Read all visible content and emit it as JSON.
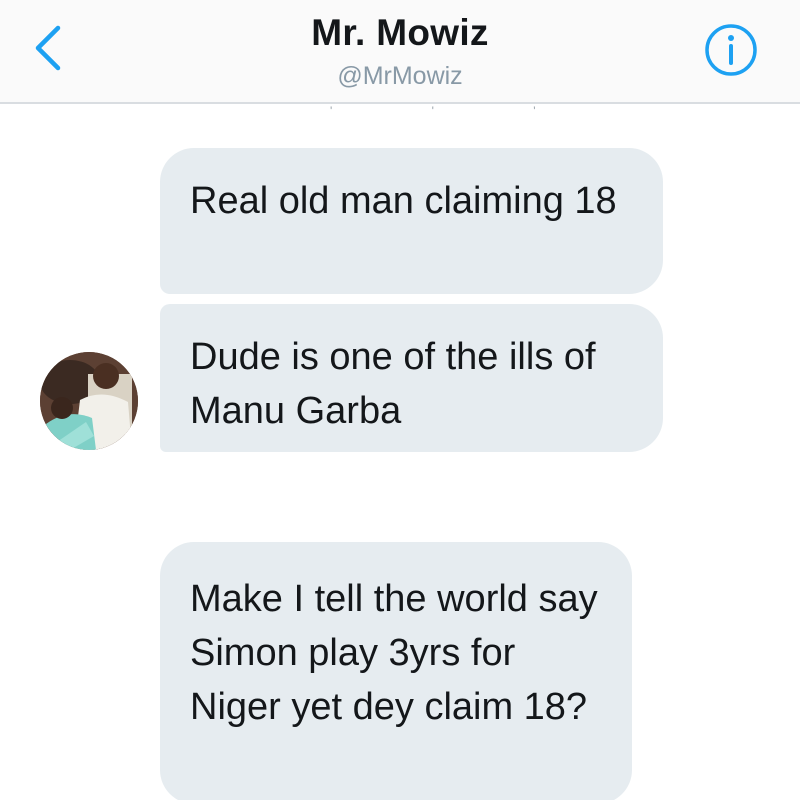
{
  "header": {
    "title": "Mr. Mowiz",
    "handle": "@MrMowiz",
    "back_icon": "chevron-left-icon",
    "info_icon": "info-circle-icon"
  },
  "messages": [
    {
      "text": "Real old man claiming 18"
    },
    {
      "text": "Dude is one of the ills of Manu Garba"
    },
    {
      "text": "Make I tell the world say Simon play 3yrs for Niger yet dey claim 18?"
    }
  ],
  "colors": {
    "accent": "#1da1f2",
    "bubble": "#e6ecf0",
    "text": "#14171a",
    "secondary_text": "#8899a6"
  }
}
